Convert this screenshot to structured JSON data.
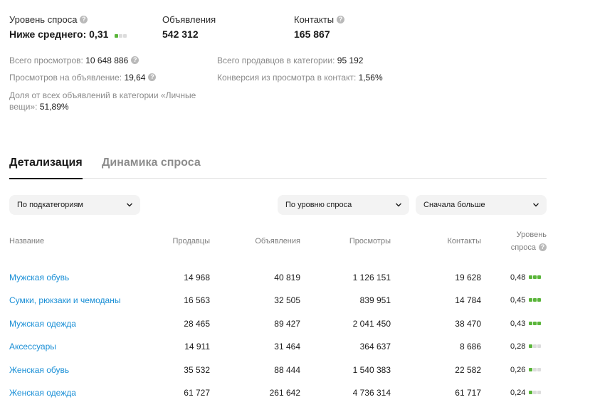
{
  "summary": {
    "demand_level": {
      "label": "Уровень спроса",
      "value": "Ниже среднего: 0,31",
      "level": 1
    },
    "ads": {
      "label": "Объявления",
      "value": "542 312"
    },
    "contacts": {
      "label": "Контакты",
      "value": "165 867"
    }
  },
  "stats": {
    "total_views": {
      "label": "Всего просмотров:",
      "value": "10 648 886"
    },
    "views_per_ad": {
      "label": "Просмотров на объявление:",
      "value": "19,64"
    },
    "share": {
      "label": "Доля от всех объявлений в категории «Личные вещи»:",
      "value": "51,89%"
    },
    "total_sellers": {
      "label": "Всего продавцов в категории:",
      "value": "95 192"
    },
    "conversion": {
      "label": "Конверсия из просмотра в контакт:",
      "value": "1,56%"
    }
  },
  "tabs": [
    {
      "label": "Детализация",
      "active": true
    },
    {
      "label": "Динамика спроса",
      "active": false
    }
  ],
  "filters": {
    "group_by": "По подкатегориям",
    "sort_field": "По уровню спроса",
    "sort_order": "Сначала больше"
  },
  "table": {
    "headers": {
      "name": "Название",
      "sellers": "Продавцы",
      "ads": "Объявления",
      "views": "Просмотры",
      "contacts": "Контакты",
      "demand_line1": "Уровень",
      "demand_line2": "спроса"
    },
    "rows": [
      {
        "name": "Мужская обувь",
        "sellers": "14 968",
        "ads": "40 819",
        "views": "1 126 151",
        "contacts": "19 628",
        "demand": "0,48",
        "level": 3
      },
      {
        "name": "Сумки, рюкзаки и чемоданы",
        "sellers": "16 563",
        "ads": "32 505",
        "views": "839 951",
        "contacts": "14 784",
        "demand": "0,45",
        "level": 3
      },
      {
        "name": "Мужская одежда",
        "sellers": "28 465",
        "ads": "89 427",
        "views": "2 041 450",
        "contacts": "38 470",
        "demand": "0,43",
        "level": 3
      },
      {
        "name": "Аксессуары",
        "sellers": "14 911",
        "ads": "31 464",
        "views": "364 637",
        "contacts": "8 686",
        "demand": "0,28",
        "level": 1
      },
      {
        "name": "Женская обувь",
        "sellers": "35 532",
        "ads": "88 444",
        "views": "1 540 383",
        "contacts": "22 582",
        "demand": "0,26",
        "level": 1
      },
      {
        "name": "Женская одежда",
        "sellers": "61 727",
        "ads": "261 642",
        "views": "4 736 314",
        "contacts": "61 717",
        "demand": "0,24",
        "level": 1
      }
    ]
  },
  "colors": {
    "link": "#1a8fd6",
    "level_on": "#5ab53a",
    "level_off": "#dcdcdc"
  }
}
